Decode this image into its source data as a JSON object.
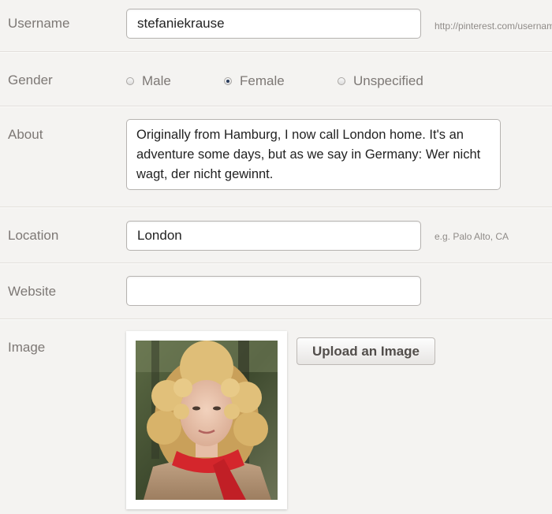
{
  "form": {
    "username": {
      "label": "Username",
      "value": "stefaniekrause",
      "hint": "http://pinterest.com/username"
    },
    "gender": {
      "label": "Gender",
      "options": [
        {
          "label": "Male",
          "checked": false
        },
        {
          "label": "Female",
          "checked": true
        },
        {
          "label": "Unspecified",
          "checked": false
        }
      ]
    },
    "about": {
      "label": "About",
      "value": "Originally from Hamburg, I now call London home. It's an adventure some days, but as we say in Germany:  Wer nicht wagt, der nicht gewinnt."
    },
    "location": {
      "label": "Location",
      "value": "London",
      "hint": "e.g. Palo Alto, CA"
    },
    "website": {
      "label": "Website",
      "value": ""
    },
    "image": {
      "label": "Image",
      "upload_label": "Upload an Image"
    }
  },
  "colors": {
    "background": "#f4f3f1",
    "label": "#7d7875",
    "input_border": "#b6b3b0",
    "scarf": "#d4262c",
    "hair": "#d9b66e"
  }
}
